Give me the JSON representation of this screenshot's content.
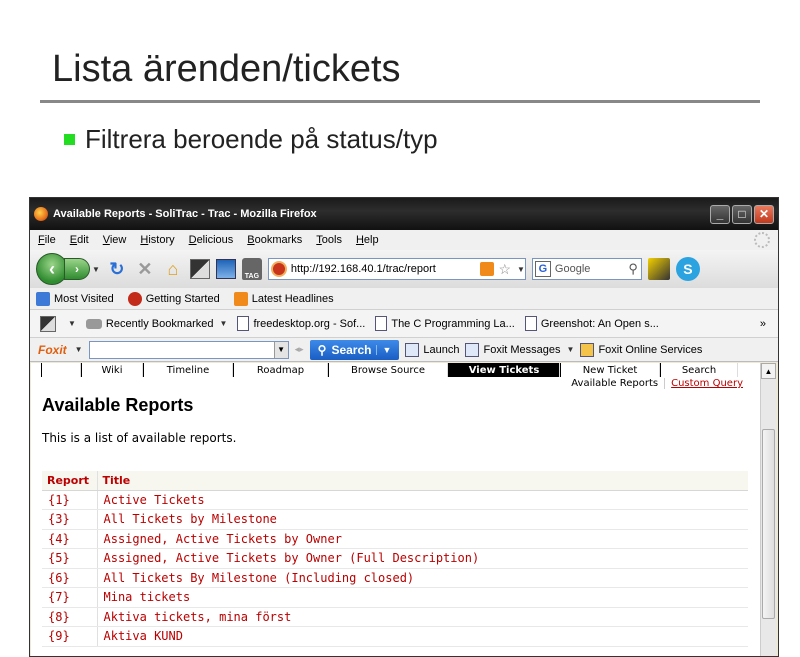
{
  "slide": {
    "title": "Lista ärenden/tickets",
    "bullet": "Filtrera beroende på status/typ"
  },
  "window": {
    "title": "Available Reports - SoliTrac - Trac - Mozilla Firefox"
  },
  "menu": [
    "File",
    "Edit",
    "View",
    "History",
    "Delicious",
    "Bookmarks",
    "Tools",
    "Help"
  ],
  "navbar": {
    "url": "http://192.168.40.1/trac/report",
    "search_engine": "Google",
    "tag_label": "TAG"
  },
  "bookmarks": [
    "Most Visited",
    "Getting Started",
    "Latest Headlines"
  ],
  "recent_bar": {
    "recently_bookmarked": "Recently Bookmarked",
    "items": [
      "freedesktop.org - Sof...",
      "The C Programming La...",
      "Greenshot: An Open s..."
    ],
    "more": "»"
  },
  "foxit": {
    "logo": "Foxit",
    "search_label": "Search",
    "launch": "Launch",
    "messages": "Foxit Messages",
    "services": "Foxit Online Services"
  },
  "trac": {
    "nav": [
      "",
      "Wiki",
      "Timeline",
      "Roadmap",
      "Browse Source",
      "View Tickets",
      "New Ticket",
      "Search"
    ],
    "active_tab": "View Tickets",
    "ctx_available": "Available Reports",
    "ctx_custom": "Custom Query",
    "heading": "Available Reports",
    "description": "This is a list of available reports.",
    "table_headers": {
      "report": "Report",
      "title": "Title"
    },
    "rows": [
      {
        "id": "{1}",
        "title": "Active Tickets"
      },
      {
        "id": "{3}",
        "title": "All Tickets by Milestone"
      },
      {
        "id": "{4}",
        "title": "Assigned, Active Tickets by Owner"
      },
      {
        "id": "{5}",
        "title": "Assigned, Active Tickets by Owner (Full Description)"
      },
      {
        "id": "{6}",
        "title": "All Tickets By Milestone (Including closed)"
      },
      {
        "id": "{7}",
        "title": "Mina tickets"
      },
      {
        "id": "{8}",
        "title": "Aktiva tickets, mina först"
      },
      {
        "id": "{9}",
        "title": "Aktiva KUND"
      }
    ]
  },
  "colors": {
    "bullet": "#22dd22",
    "link": "#bb0000",
    "titlebar": "#1a1a1a"
  }
}
